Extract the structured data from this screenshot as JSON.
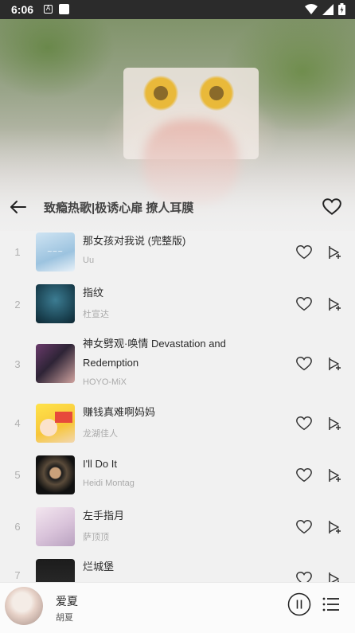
{
  "status_bar": {
    "time": "6:06",
    "notif_letter": "A"
  },
  "header": {
    "title": "致瘾热歌|极诱心扉 撩人耳膜"
  },
  "songs": [
    {
      "index": "1",
      "title": "那女孩对我说 (完整版)",
      "artist": "Uu"
    },
    {
      "index": "2",
      "title": "指纹",
      "artist": "杜宣达"
    },
    {
      "index": "3",
      "title": "神女劈观·唤情 Devastation and Redemption",
      "artist": "HOYO-MiX"
    },
    {
      "index": "4",
      "title": "赚钱真难啊妈妈",
      "artist": "龙湖佳人"
    },
    {
      "index": "5",
      "title": "I'll Do It",
      "artist": "Heidi Montag"
    },
    {
      "index": "6",
      "title": "左手指月",
      "artist": "萨顶顶"
    },
    {
      "index": "7",
      "title": "烂城堡",
      "artist": ""
    }
  ],
  "player": {
    "title": "爱夏",
    "artist": "胡夏"
  },
  "colors": {
    "icon": "#333333",
    "muted": "#b0b0b0"
  }
}
